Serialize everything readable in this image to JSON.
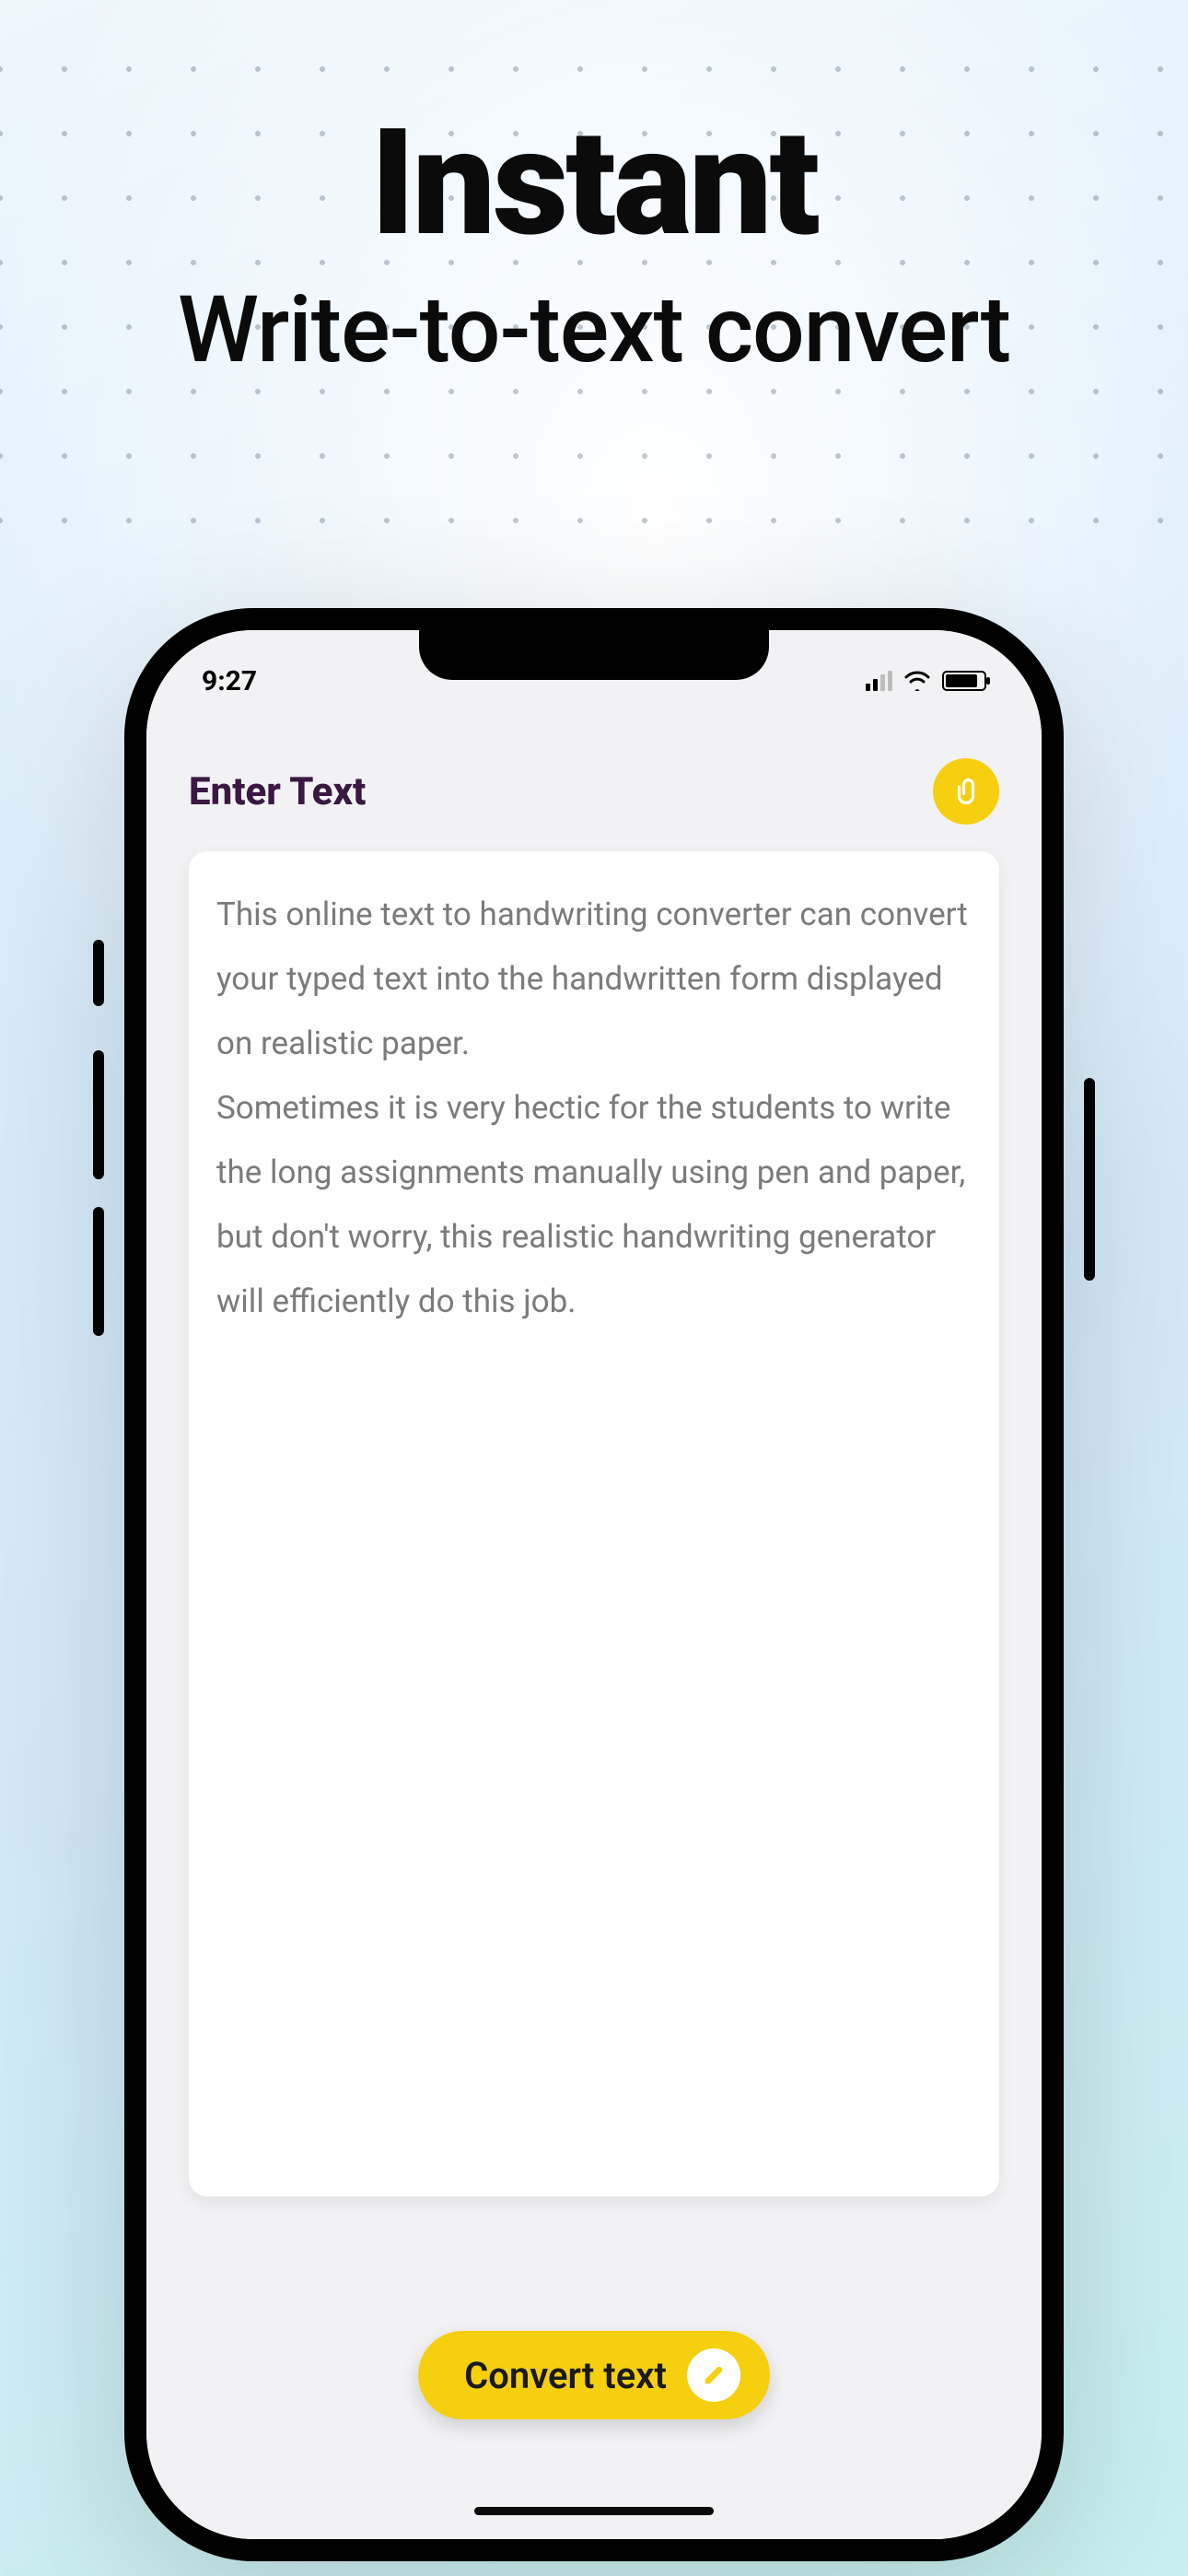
{
  "hero": {
    "title": "Instant",
    "subtitle": "Write-to-text convert"
  },
  "status": {
    "time": "9:27"
  },
  "screen": {
    "title": "Enter Text",
    "body_p1": "This online text to handwriting converter can convert your typed text into the handwritten form displayed on realistic paper.",
    "body_p2": "Sometimes it is very hectic for the students to write the long assignments manually using pen and paper, but don't worry, this realistic handwriting generator will efficiently do this job."
  },
  "actions": {
    "convert_label": "Convert text"
  },
  "colors": {
    "accent": "#f6cf0e",
    "title_purple": "#3a1842"
  }
}
